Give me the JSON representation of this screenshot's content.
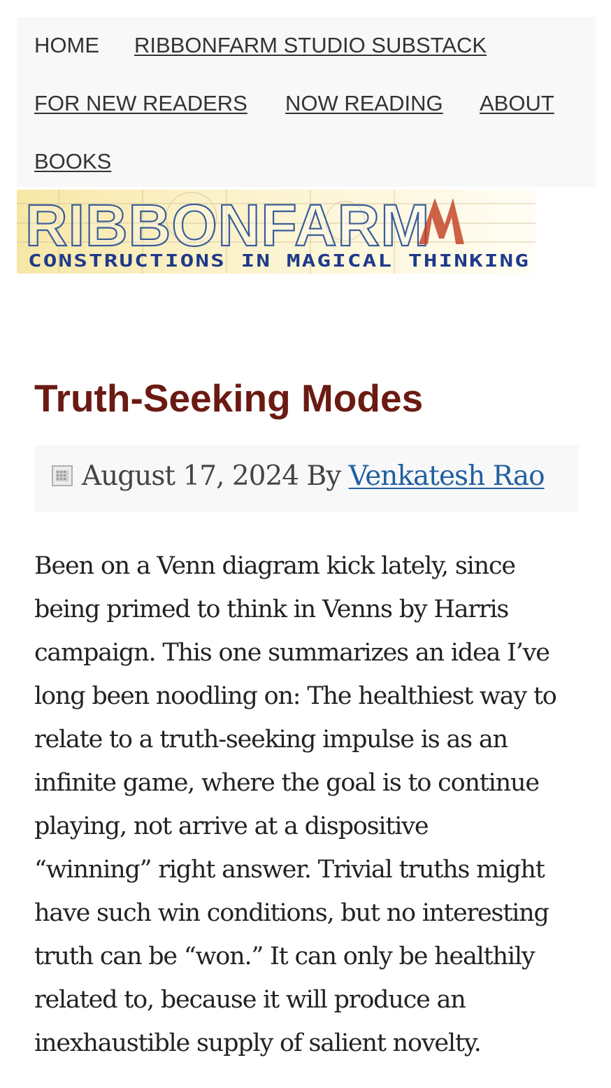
{
  "nav": {
    "items": [
      {
        "label": "HOME"
      },
      {
        "label": "RIBBONFARM STUDIO SUBSTACK"
      },
      {
        "label": "FOR NEW READERS"
      },
      {
        "label": "NOW READING"
      },
      {
        "label": "ABOUT"
      },
      {
        "label": "BOOKS"
      }
    ]
  },
  "banner": {
    "site_name": "RIBBONFARM",
    "tagline": "CONSTRUCTIONS IN MAGICAL THINKING"
  },
  "post": {
    "title": "Truth-Seeking Modes",
    "date": "August 17, 2024",
    "by_label": "By",
    "author": "Venkatesh Rao",
    "body_lines": [
      "Been on a Venn diagram kick lately, since",
      "being primed to think in Venns by Harris",
      "campaign. This one summarizes an idea I’ve",
      "long been noodling on: The healthiest way to",
      "relate to a truth-seeking impulse is as an",
      "infinite game, where the goal is to continue",
      "playing, not arrive at a dispositive",
      "“winning” right answer. Trivial truths might",
      "have such win conditions, but no interesting",
      "truth can be “won.” It can only be healthily",
      "related to, because it will produce an",
      "inexhaustible supply of salient novelty."
    ]
  },
  "colors": {
    "title": "#6b1a12",
    "link": "#205fa0",
    "nav_bg": "#f8f8f8"
  }
}
